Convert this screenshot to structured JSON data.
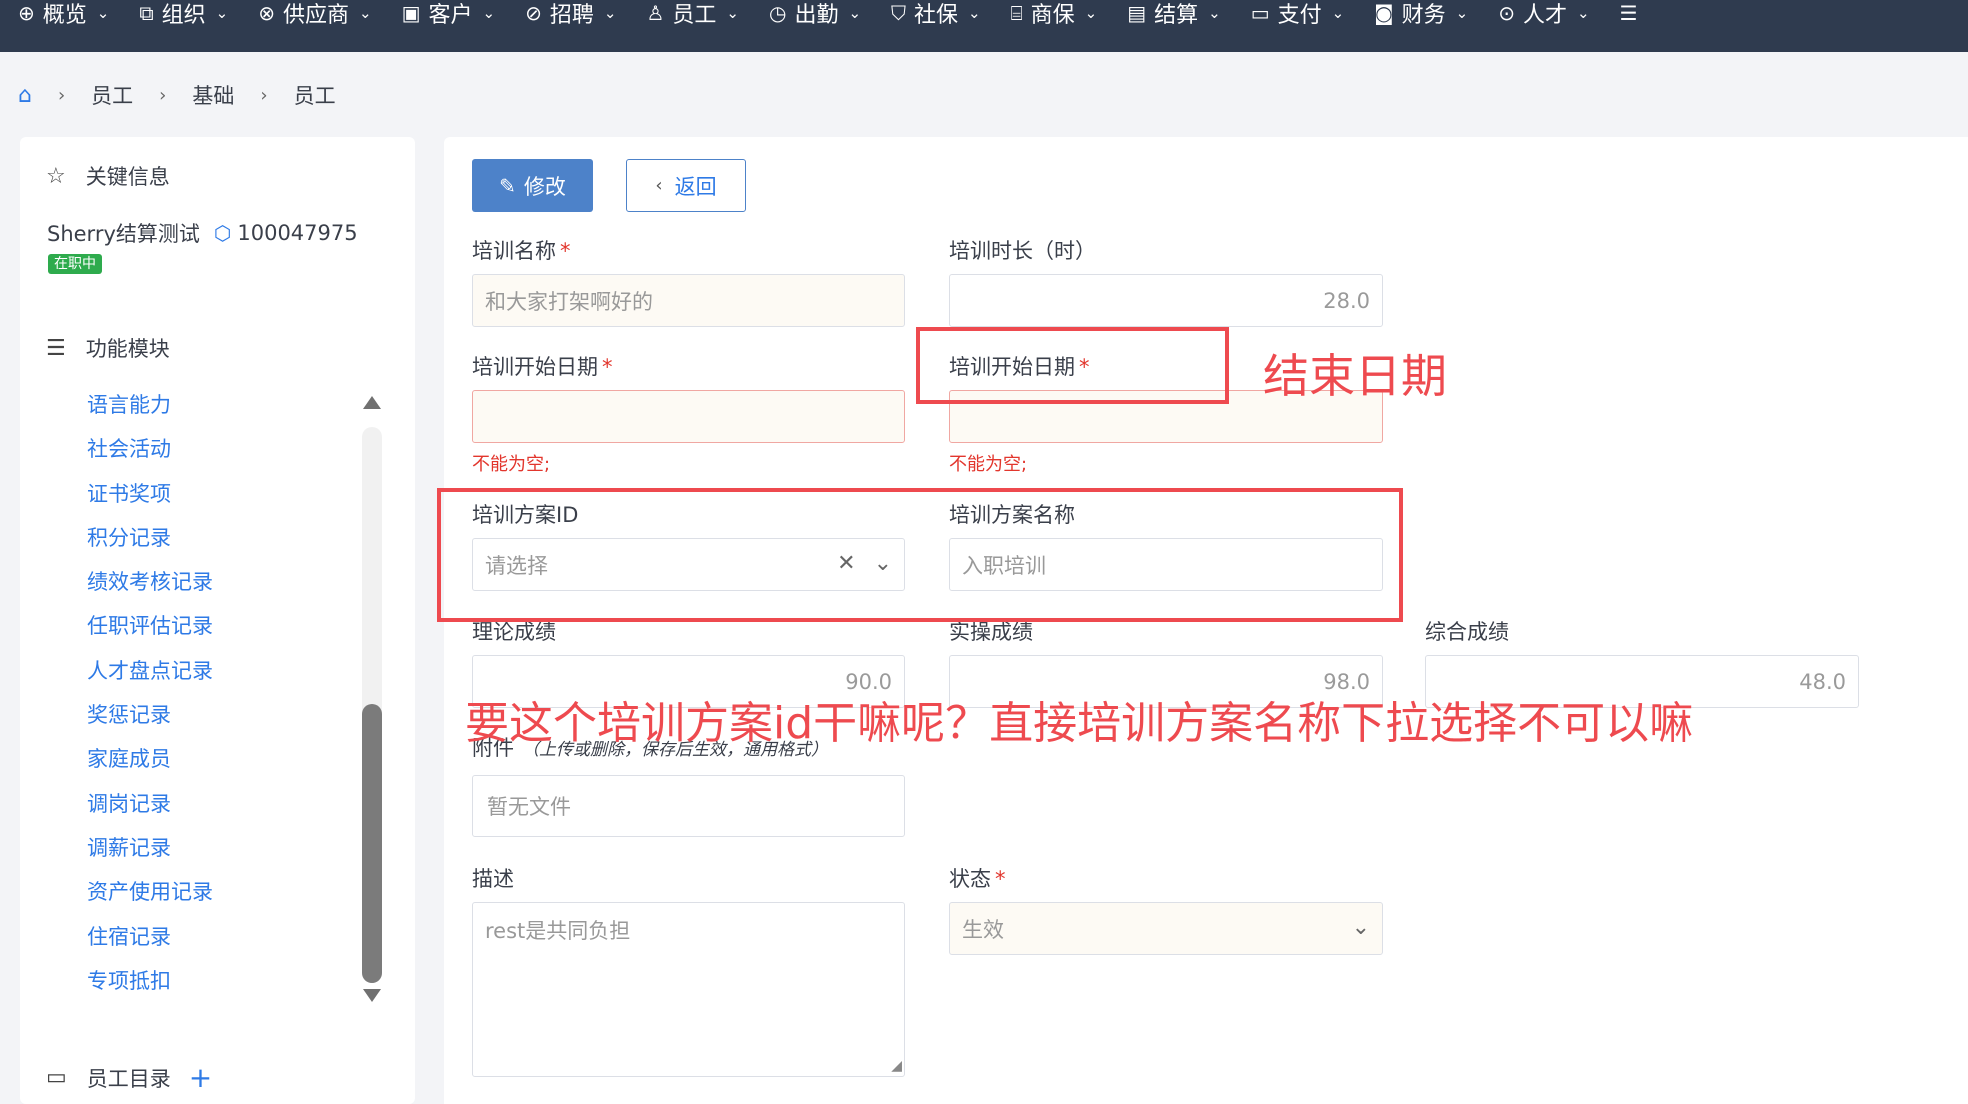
{
  "topnav": {
    "items": [
      {
        "label": "概览",
        "icon": "globe-icon",
        "glyph": "⊕"
      },
      {
        "label": "组织",
        "icon": "org-chart-icon",
        "glyph": "⧉"
      },
      {
        "label": "供应商",
        "icon": "link-icon",
        "glyph": "⊗"
      },
      {
        "label": "客户",
        "icon": "briefcase-icon",
        "glyph": "▣"
      },
      {
        "label": "招聘",
        "icon": "check-circle-icon",
        "glyph": "⊘"
      },
      {
        "label": "员工",
        "icon": "user-icon",
        "glyph": "♙"
      },
      {
        "label": "出勤",
        "icon": "clock-icon",
        "glyph": "◷"
      },
      {
        "label": "社保",
        "icon": "shield-icon",
        "glyph": "⛉"
      },
      {
        "label": "商保",
        "icon": "gift-icon",
        "glyph": "⌸"
      },
      {
        "label": "结算",
        "icon": "document-icon",
        "glyph": "▤"
      },
      {
        "label": "支付",
        "icon": "wallet-icon",
        "glyph": "▭"
      },
      {
        "label": "财务",
        "icon": "camera-icon",
        "glyph": "◙"
      },
      {
        "label": "人才",
        "icon": "badge-check-icon",
        "glyph": "⊙"
      },
      {
        "label": "",
        "icon": "menu-icon",
        "glyph": "☰"
      }
    ],
    "chevron": "⌄"
  },
  "breadcrumb": {
    "home_glyph": "⌂",
    "sep": "›",
    "items": [
      "员工",
      "基础",
      "员工"
    ]
  },
  "left": {
    "key_info_label": "关键信息",
    "key_info_glyph": "☆",
    "employee_name": "Sherry结算测试",
    "employee_id": "100047975",
    "tag_glyph": "⬡",
    "status_badge": "在职中",
    "modules_label": "功能模块",
    "modules_glyph": "☰",
    "modules": [
      "语言能力",
      "社会活动",
      "证书奖项",
      "积分记录",
      "绩效考核记录",
      "任职评估记录",
      "人才盘点记录",
      "奖惩记录",
      "家庭成员",
      "调岗记录",
      "调薪记录",
      "资产使用记录",
      "住宿记录",
      "专项抵扣"
    ],
    "directory_label": "员工目录",
    "directory_glyph": "▭",
    "add_glyph": "+"
  },
  "form": {
    "edit_button": "修改",
    "edit_glyph": "✎",
    "back_button": "返回",
    "back_glyph": "‹",
    "required_mark": "*",
    "training_name_label": "培训名称",
    "training_name_value": "和大家打架啊好的",
    "training_hours_label": "培训时长（时）",
    "training_hours_value": "28.0",
    "start_date_label": "培训开始日期",
    "end_date_label": "培训开始日期",
    "error_text": "不能为空;",
    "plan_id_label": "培训方案ID",
    "plan_id_placeholder": "请选择",
    "clear_glyph": "✕",
    "dropdown_glyph": "⌄",
    "plan_name_label": "培训方案名称",
    "plan_name_value": "入职培训",
    "theory_label": "理论成绩",
    "theory_value": "90.0",
    "practice_label": "实操成绩",
    "practice_value": "98.0",
    "overall_label": "综合成绩",
    "overall_value": "48.0",
    "attachment_label": "附件",
    "attachment_hint": "（上传或删除，保存后生效，通用格式）",
    "attachment_value": "暂无文件",
    "description_label": "描述",
    "description_value": "rest是共同负担",
    "status_label": "状态",
    "status_value": "生效"
  },
  "annotations": {
    "end_date_note": "结束日期",
    "plan_id_note": "要这个培训方案id干嘛呢？直接培训方案名称下拉选择不可以嘛",
    "color": "#ee4a4f"
  },
  "colors": {
    "nav_bg": "#2f3b4f",
    "primary": "#4d82c9",
    "link": "#2e7ae6",
    "success": "#2eab4d",
    "error": "#e2362d"
  }
}
